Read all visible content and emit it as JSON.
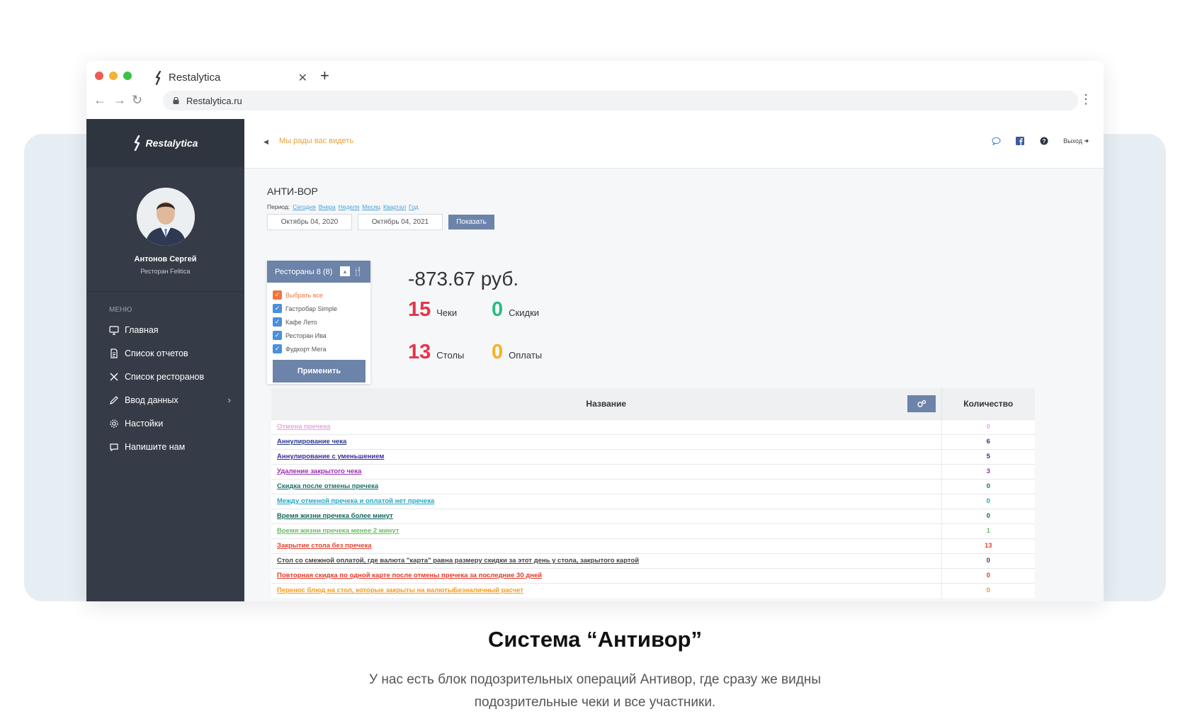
{
  "browser": {
    "tab_title": "Restalytica",
    "url": "Restalytica.ru"
  },
  "sidebar": {
    "logo": "Restalytica",
    "user_name": "Антонов Сергей",
    "user_restaurant": "Ресторан Felitica",
    "menu_title": "МЕНЮ",
    "items": [
      {
        "label": "Главная",
        "icon": "monitor-icon"
      },
      {
        "label": "Список отчетов",
        "icon": "document-icon"
      },
      {
        "label": "Список ресторанов",
        "icon": "cutlery-icon"
      },
      {
        "label": "Ввод данных",
        "icon": "pencil-icon"
      },
      {
        "label": "Настойки",
        "icon": "gear-icon"
      },
      {
        "label": "Напишите нам",
        "icon": "chat-icon"
      }
    ]
  },
  "topbar": {
    "welcome": "Мы рады вас видеть",
    "logout": "Выход"
  },
  "page": {
    "title": "АНТИ-ВОР",
    "period_label": "Период:",
    "period_links": [
      "Сегодня",
      "Вчера",
      "Неделя",
      "Месяц",
      "Квартал",
      "Год"
    ],
    "date_from": "Октябрь 04, 2020",
    "date_to": "Октябрь 04, 2021",
    "show_button": "Показать"
  },
  "restaurants": {
    "header": "Рестораны 8 (8)",
    "select_all": "Выбрать все",
    "items": [
      "Гастробар Simple",
      "Кафе Лето",
      "Ресторан Ива",
      "Фудкорт Мега"
    ],
    "apply": "Применить"
  },
  "summary": {
    "total": "-873.67 руб.",
    "checks": {
      "value": "15",
      "label": "Чеки",
      "color": "#e8334a"
    },
    "discounts": {
      "value": "0",
      "label": "Скидки",
      "color": "#2bbd7e"
    },
    "tables": {
      "value": "13",
      "label": "Столы",
      "color": "#e8334a"
    },
    "payments": {
      "value": "0",
      "label": "Оплаты",
      "color": "#f5b21b"
    }
  },
  "table": {
    "col_name": "Название",
    "col_qty": "Количество",
    "rows": [
      {
        "name": "Отмена пречека",
        "qty": "0",
        "color": "#e7a6e0"
      },
      {
        "name": "Аннулирование чека",
        "qty": "6",
        "color": "#2d3a8c"
      },
      {
        "name": "Аннулирование с уменьшением",
        "qty": "5",
        "color": "#3a2ca0"
      },
      {
        "name": "Удаление закрытого чека",
        "qty": "3",
        "color": "#9b2fb5"
      },
      {
        "name": "Скидка после отмены пречека",
        "qty": "0",
        "color": "#1d6e6a"
      },
      {
        "name": "Между отменой пречека и оплатой нет пречека",
        "qty": "0",
        "color": "#22a8c6"
      },
      {
        "name": "Время жизни пречека более минут",
        "qty": "0",
        "color": "#10665c"
      },
      {
        "name": "Время жизни пречека менее 2 минут",
        "qty": "1",
        "color": "#6abf63"
      },
      {
        "name": "Закрытие стола без пречека",
        "qty": "13",
        "color": "#e2422f"
      },
      {
        "name": "Стол со смежной оплатой, где валюта \"карта\" равна размеру скидки за этот день у стола, закрытого картой",
        "qty": "0",
        "color": "#444444"
      },
      {
        "name": "Повторная скидка по одной карте после отмены пречека за последние 30 дней",
        "qty": "0",
        "color": "#e53928"
      },
      {
        "name": "Перенос блюд на стол, которые закрыты на валютыБезналичный расчет",
        "qty": "0",
        "color": "#f59b1a"
      }
    ]
  },
  "caption": {
    "title": "Система “Антивор”",
    "text": "У нас есть блок подозрительных операций Антивор, где сразу же видны подозрительные чеки и все участники."
  }
}
